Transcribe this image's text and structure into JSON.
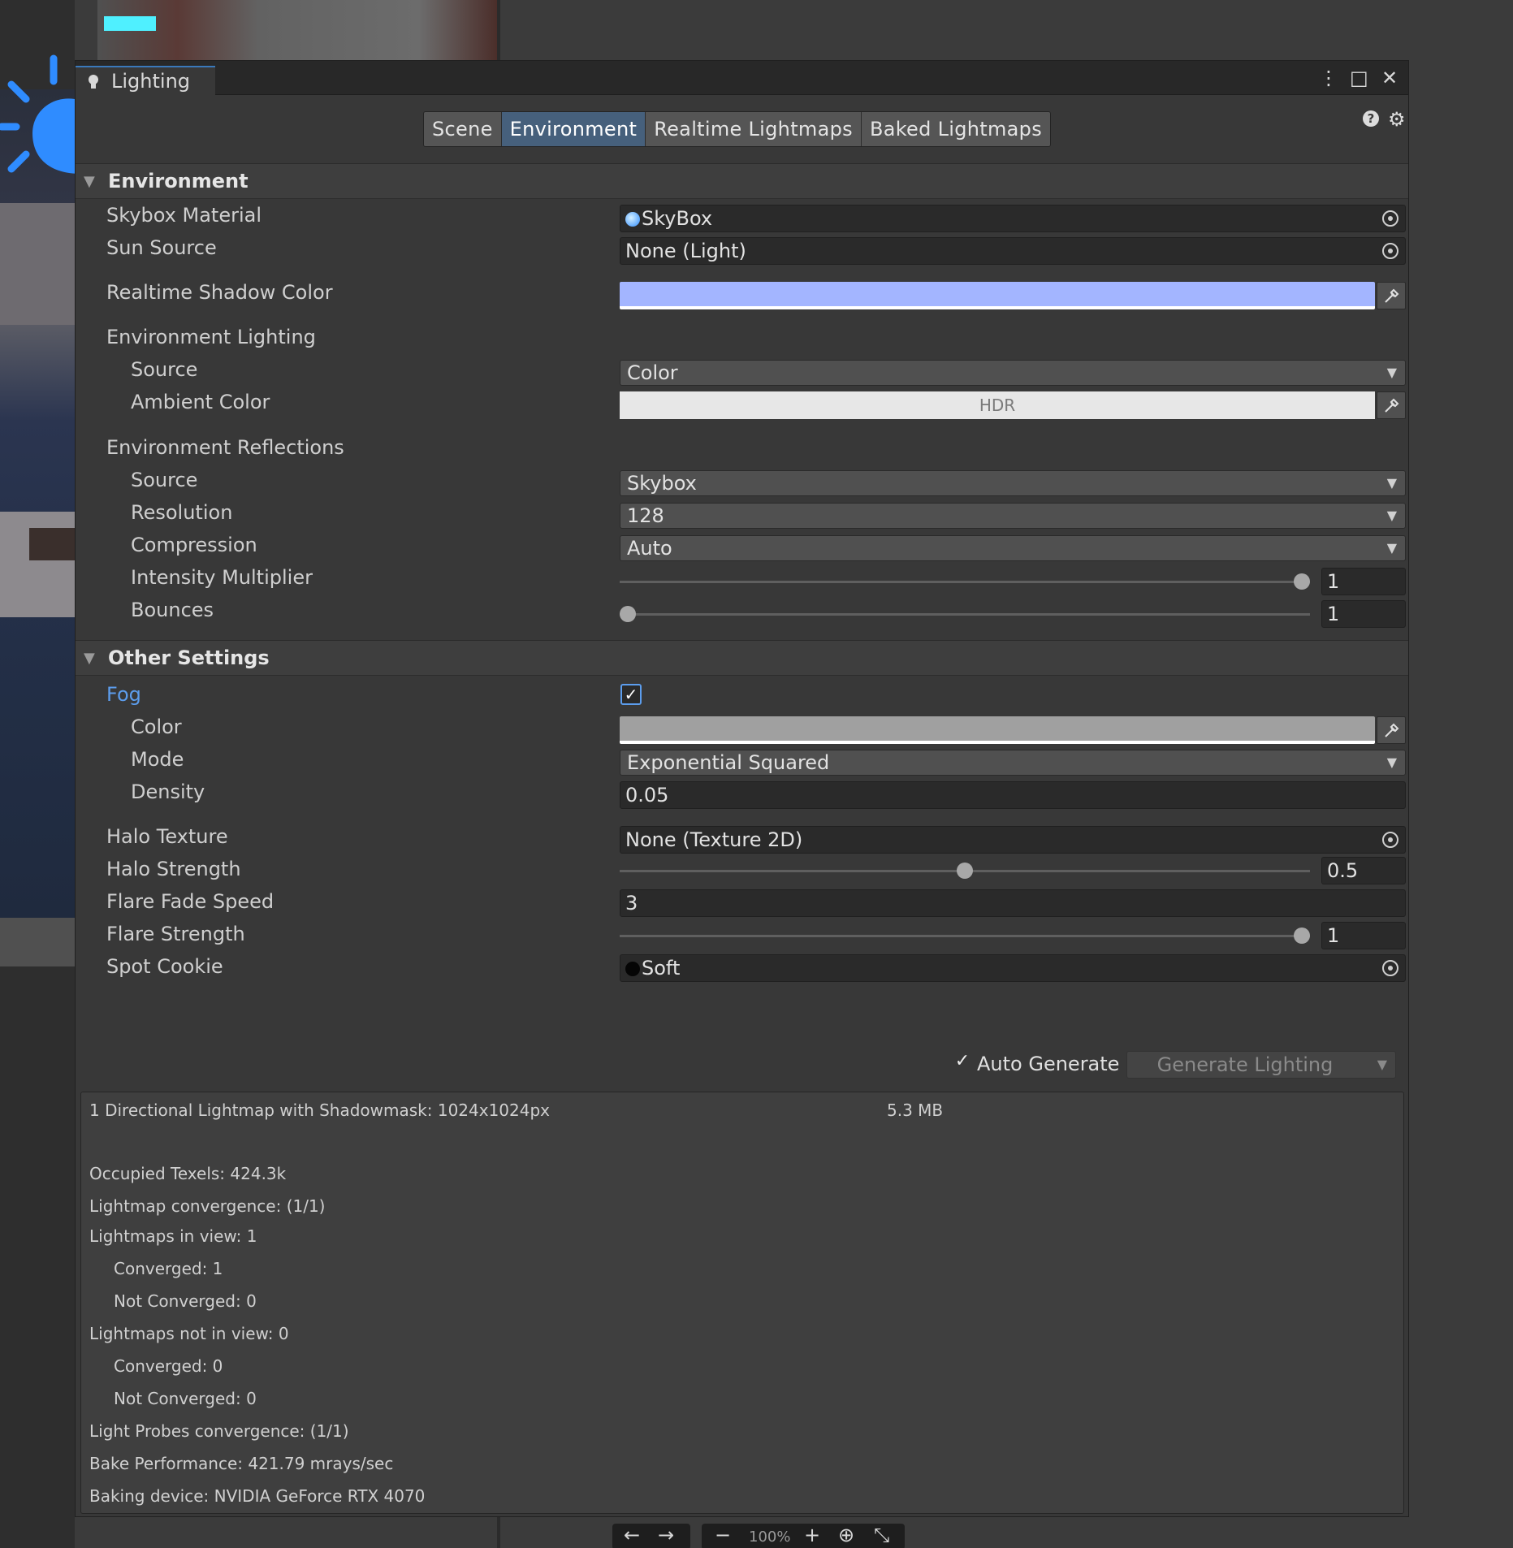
{
  "window": {
    "tab_title": "Lighting",
    "controls": {
      "menu": "⋮",
      "maximize": "□",
      "close": "✕"
    }
  },
  "toolbar": {
    "tabs": [
      "Scene",
      "Environment",
      "Realtime Lightmaps",
      "Baked Lightmaps"
    ],
    "active_tab": "Environment",
    "help_icon": "?",
    "settings_icon": "⚙"
  },
  "environment": {
    "header": "Environment",
    "skybox_material": {
      "label": "Skybox Material",
      "value": "SkyBox"
    },
    "sun_source": {
      "label": "Sun Source",
      "value": "None (Light)"
    },
    "realtime_shadow_color": {
      "label": "Realtime Shadow Color",
      "color": "#a3b5ff"
    },
    "env_lighting": {
      "label": "Environment Lighting",
      "source": {
        "label": "Source",
        "value": "Color"
      },
      "ambient_color": {
        "label": "Ambient Color",
        "hdr_text": "HDR",
        "color": "#e7e7e7"
      }
    },
    "env_reflections": {
      "label": "Environment Reflections",
      "source": {
        "label": "Source",
        "value": "Skybox"
      },
      "resolution": {
        "label": "Resolution",
        "value": "128"
      },
      "compression": {
        "label": "Compression",
        "value": "Auto"
      },
      "intensity_multiplier": {
        "label": "Intensity Multiplier",
        "value": "1",
        "fraction": 1.0
      },
      "bounces": {
        "label": "Bounces",
        "value": "1",
        "fraction": 0.0
      }
    }
  },
  "other_settings": {
    "header": "Other Settings",
    "fog": {
      "label": "Fog",
      "checked": true,
      "check_glyph": "✓",
      "color": {
        "label": "Color",
        "color": "#a0a0a0"
      },
      "mode": {
        "label": "Mode",
        "value": "Exponential Squared"
      },
      "density": {
        "label": "Density",
        "value": "0.05"
      }
    },
    "halo_texture": {
      "label": "Halo Texture",
      "value": "None (Texture 2D)"
    },
    "halo_strength": {
      "label": "Halo Strength",
      "value": "0.5",
      "fraction": 0.5
    },
    "flare_fade_speed": {
      "label": "Flare Fade Speed",
      "value": "3"
    },
    "flare_strength": {
      "label": "Flare Strength",
      "value": "1",
      "fraction": 1.0
    },
    "spot_cookie": {
      "label": "Spot Cookie",
      "value": "Soft"
    }
  },
  "bake": {
    "auto_generate": {
      "label": "Auto Generate",
      "checked": true,
      "check_glyph": "✓"
    },
    "generate_button": "Generate Lighting",
    "stats": {
      "lightmap_line": "1 Directional Lightmap with Shadowmask: 1024x1024px",
      "lightmap_size": "5.3 MB",
      "occupied_texels": "Occupied Texels: 424.3k",
      "lightmap_convergence": "Lightmap convergence: (1/1)",
      "lightmaps_in_view": "Lightmaps in view: 1",
      "in_view_converged": "Converged: 1",
      "in_view_not_converged": "Not Converged: 0",
      "lightmaps_not_in_view": "Lightmaps not in view: 0",
      "not_in_view_converged": "Converged: 0",
      "not_in_view_not_converged": "Not Converged: 0",
      "light_probes": "Light Probes convergence: (1/1)",
      "bake_performance": "Bake Performance: 421.79 mrays/sec",
      "baking_device": "Baking device: NVIDIA GeForce RTX 4070"
    }
  },
  "scene_nav": {
    "back": "←",
    "forward": "→",
    "zoom_out": "−",
    "zoom_level": "100%",
    "zoom_in": "+",
    "reset_icon": "⊕",
    "fit_icon": "⤡"
  },
  "colors": {
    "accent": "#3a79bb",
    "active_tab": "#46607c",
    "fog_label": "#5c9ded"
  }
}
